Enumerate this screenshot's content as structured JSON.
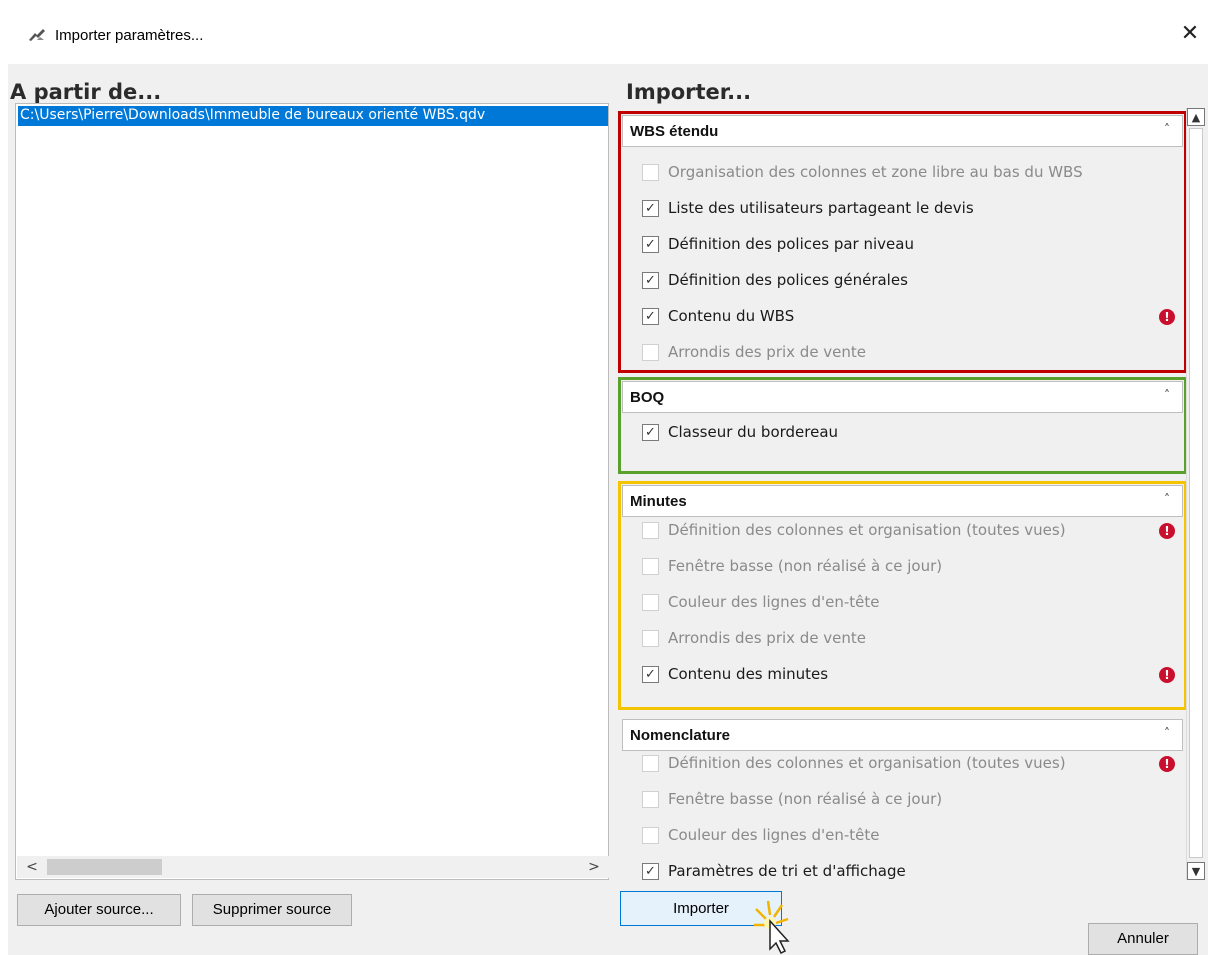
{
  "window": {
    "title": "Importer paramètres...",
    "close_glyph": "✕",
    "icon": "gear-import-icon"
  },
  "left_panel": {
    "header": "A partir de...",
    "sources": [
      "C:\\Users\\Pierre\\Downloads\\Immeuble de bureaux orienté WBS.qdv"
    ],
    "scroll_left": "<",
    "scroll_right": ">"
  },
  "right_panel": {
    "header": "Importer...",
    "groups": [
      {
        "title": "WBS étendu",
        "highlight_color": "#c00000",
        "items": [
          {
            "label": "Organisation des colonnes et zone libre au bas du WBS",
            "checked": false,
            "enabled": false,
            "warning": false
          },
          {
            "label": "Liste des utilisateurs partageant le devis",
            "checked": true,
            "enabled": true,
            "warning": false
          },
          {
            "label": "Définition des polices par niveau",
            "checked": true,
            "enabled": true,
            "warning": false
          },
          {
            "label": "Définition des polices générales",
            "checked": true,
            "enabled": true,
            "warning": false
          },
          {
            "label": "Contenu du WBS",
            "checked": true,
            "enabled": true,
            "warning": true
          },
          {
            "label": "Arrondis des prix de vente",
            "checked": false,
            "enabled": false,
            "warning": false
          }
        ]
      },
      {
        "title": "BOQ",
        "highlight_color": "#5aa02c",
        "items": [
          {
            "label": "Classeur du bordereau",
            "checked": true,
            "enabled": true,
            "warning": false
          }
        ]
      },
      {
        "title": "Minutes",
        "highlight_color": "#f5c400",
        "items": [
          {
            "label": "Définition des colonnes et organisation (toutes vues)",
            "checked": false,
            "enabled": false,
            "warning": true
          },
          {
            "label": "Fenêtre basse (non réalisé à ce jour)",
            "checked": false,
            "enabled": false,
            "warning": false
          },
          {
            "label": "Couleur des lignes d'en-tête",
            "checked": false,
            "enabled": false,
            "warning": false
          },
          {
            "label": "Arrondis des prix de vente",
            "checked": false,
            "enabled": false,
            "warning": false
          },
          {
            "label": "Contenu des minutes",
            "checked": true,
            "enabled": true,
            "warning": true
          }
        ]
      },
      {
        "title": "Nomenclature",
        "highlight_color": "",
        "items": [
          {
            "label": "Définition des colonnes et organisation (toutes vues)",
            "checked": false,
            "enabled": false,
            "warning": true
          },
          {
            "label": "Fenêtre basse (non réalisé à ce jour)",
            "checked": false,
            "enabled": false,
            "warning": false
          },
          {
            "label": "Couleur des lignes d'en-tête",
            "checked": false,
            "enabled": false,
            "warning": false
          },
          {
            "label": "Paramètres de tri et d'affichage",
            "checked": true,
            "enabled": true,
            "warning": false
          }
        ]
      }
    ]
  },
  "buttons": {
    "add_source": "Ajouter source...",
    "remove_source": "Supprimer source",
    "import": "Importer",
    "cancel": "Annuler"
  },
  "glyphs": {
    "check": "✓",
    "chevron_up": "˄",
    "warning": "!",
    "scroll_up": "▲",
    "scroll_down": "▼"
  }
}
